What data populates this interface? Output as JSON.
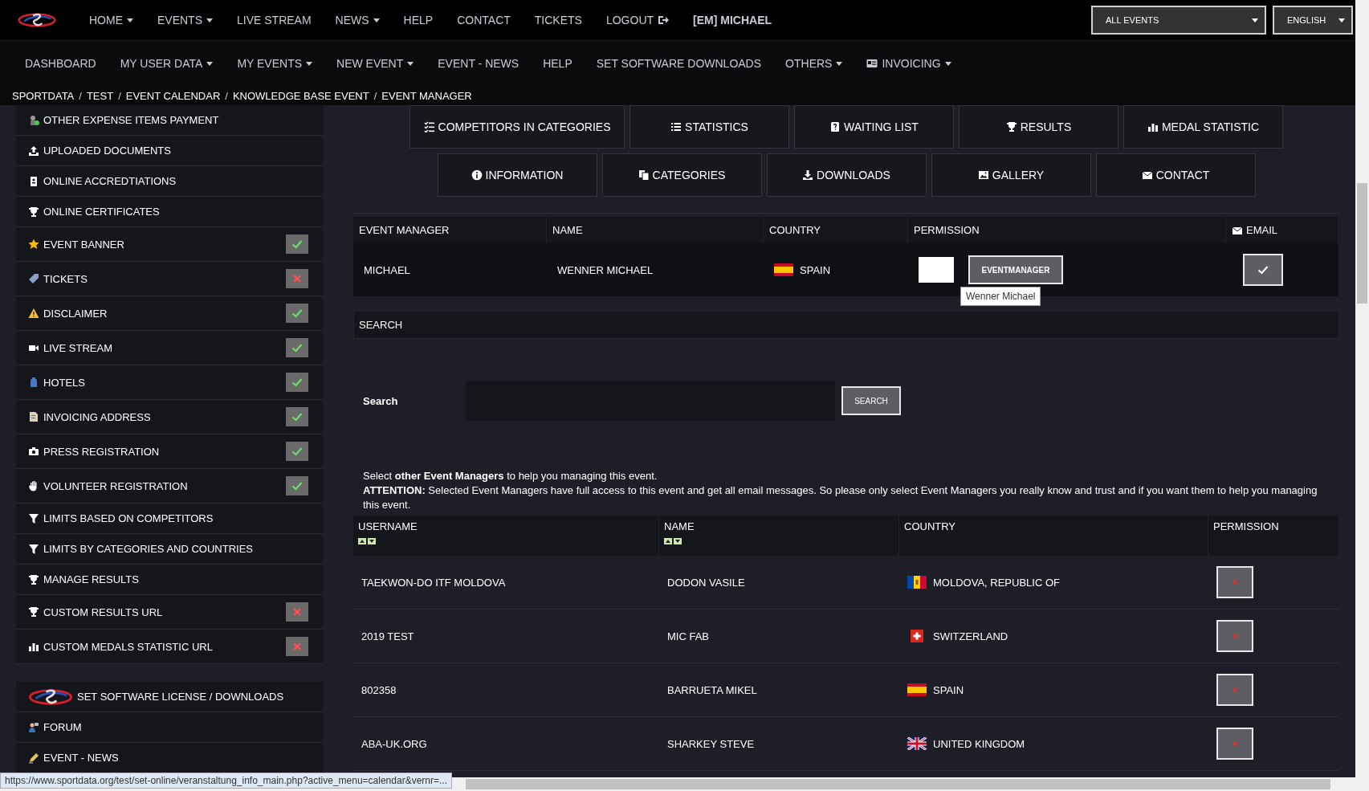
{
  "top_nav": {
    "items": [
      {
        "label": "HOME",
        "kind": "dropdown"
      },
      {
        "label": "EVENTS",
        "kind": "dropdown"
      },
      {
        "label": "LIVE STREAM",
        "kind": "link"
      },
      {
        "label": "NEWS",
        "kind": "dropdown"
      },
      {
        "label": "HELP",
        "kind": "link"
      },
      {
        "label": "CONTACT",
        "kind": "link"
      },
      {
        "label": "TICKETS",
        "kind": "link"
      },
      {
        "label": "LOGOUT",
        "kind": "logout"
      },
      {
        "label": "[EM] MICHAEL",
        "kind": "user"
      }
    ],
    "selectors": [
      {
        "value": "ALL EVENTS"
      },
      {
        "value": "ENGLISH"
      }
    ]
  },
  "sub_nav": [
    {
      "label": "DASHBOARD",
      "kind": "link"
    },
    {
      "label": "MY USER DATA",
      "kind": "dropdown"
    },
    {
      "label": "MY EVENTS",
      "kind": "dropdown"
    },
    {
      "label": "NEW EVENT",
      "kind": "dropdown"
    },
    {
      "label": "EVENT - NEWS",
      "kind": "link"
    },
    {
      "label": "HELP",
      "kind": "link"
    },
    {
      "label": "SET SOFTWARE DOWNLOADS",
      "kind": "link"
    },
    {
      "label": "OTHERS",
      "kind": "dropdown"
    },
    {
      "label": "INVOICING",
      "kind": "icon_dropdown"
    }
  ],
  "breadcrumb": {
    "separator": "/",
    "items": [
      "SPORTDATA",
      "TEST",
      "EVENT CALENDAR",
      "KNOWLEDGE BASE EVENT",
      "EVENT MANAGER"
    ]
  },
  "sidebar": {
    "items": [
      {
        "label": "OTHER EXPENSE ITEMS PAYMENT"
      },
      {
        "label": "UPLOADED DOCUMENTS"
      },
      {
        "label": "ONLINE ACCREDTIATIONS"
      },
      {
        "label": "ONLINE CERTIFICATES"
      },
      {
        "label": "EVENT BANNER",
        "kind": "done"
      },
      {
        "label": "TICKETS",
        "kind": "missing"
      },
      {
        "label": "DISCLAIMER",
        "kind": "done"
      },
      {
        "label": "LIVE STREAM",
        "kind": "done"
      },
      {
        "label": "HOTELS",
        "kind": "done"
      },
      {
        "label": "INVOICING ADDRESS",
        "kind": "done"
      },
      {
        "label": "PRESS REGISTRATION",
        "kind": "done"
      },
      {
        "label": "VOLUNTEER REGISTRATION",
        "kind": "done"
      },
      {
        "label": "LIMITS BASED ON COMPETITORS"
      },
      {
        "label": "LIMITS BY CATEGORIES AND COUNTRIES"
      },
      {
        "label": "MANAGE RESULTS"
      },
      {
        "label": "CUSTOM RESULTS URL",
        "kind": "missing"
      },
      {
        "label": "CUSTOM MEDALS STATISTIC URL",
        "kind": "missing"
      }
    ],
    "links": [
      {
        "label": "SET SOFTWARE LICENSE / DOWNLOADS"
      },
      {
        "label": "FORUM"
      },
      {
        "label": "EVENT - NEWS"
      }
    ]
  },
  "tabs": [
    [
      {
        "label": "COMPETITORS IN CATEGORIES"
      },
      {
        "label": "STATISTICS"
      },
      {
        "label": "WAITING LIST"
      },
      {
        "label": "RESULTS"
      },
      {
        "label": "MEDAL STATISTIC"
      }
    ],
    [
      {
        "label": "INFORMATION"
      },
      {
        "label": "CATEGORIES"
      },
      {
        "label": "DOWNLOADS"
      },
      {
        "label": "GALLERY"
      },
      {
        "label": "CONTACT"
      }
    ]
  ],
  "event_manager": {
    "columns": [
      "EVENT MANAGER",
      "NAME",
      "COUNTRY",
      "PERMISSION",
      "EMAIL"
    ],
    "rows": [
      {
        "event_manager": "MICHAEL",
        "name": "WENNER MICHAEL",
        "country": "SPAIN",
        "kind": "es",
        "permission": "EVENTMANAGER",
        "tooltip": "Wenner Michael",
        "email": true
      }
    ]
  },
  "search": {
    "header": "SEARCH",
    "label": "Search",
    "button": "SEARCH"
  },
  "notice": [
    "Select **other Event Managers** to help you managing this event.",
    "**ATTENTION:** Selected Event Managers have full access to this event and get all email messages. So please only select Event Managers you really know and trust and if you want them to help you managing this event."
  ],
  "users": {
    "columns": [
      {
        "label": "USERNAME",
        "sortable": true
      },
      {
        "label": "NAME",
        "sortable": true
      },
      {
        "label": "COUNTRY",
        "sortable": false
      },
      {
        "label": "PERMISSION",
        "sortable": false
      }
    ],
    "rows": [
      {
        "username": "TAEKWON-DO ITF MOLDOVA",
        "name": "DODON VASILE",
        "country": "MOLDOVA, REPUBLIC OF",
        "kind": "md"
      },
      {
        "username": "2019 TEST",
        "name": "MIC FAB",
        "country": "SWITZERLAND",
        "kind": "ch"
      },
      {
        "username": "802358",
        "name": "BARRUETA MIKEL",
        "country": "SPAIN",
        "kind": "es"
      },
      {
        "username": "ABA-UK.ORG",
        "name": "SHARKEY STEVE",
        "country": "UNITED KINGDOM",
        "kind": "gb"
      }
    ]
  },
  "status_bar": {
    "url": "https://www.sportdata.org/test/set-online/veranstaltung_info_main.php?active_menu=calendar&vernr=..."
  }
}
